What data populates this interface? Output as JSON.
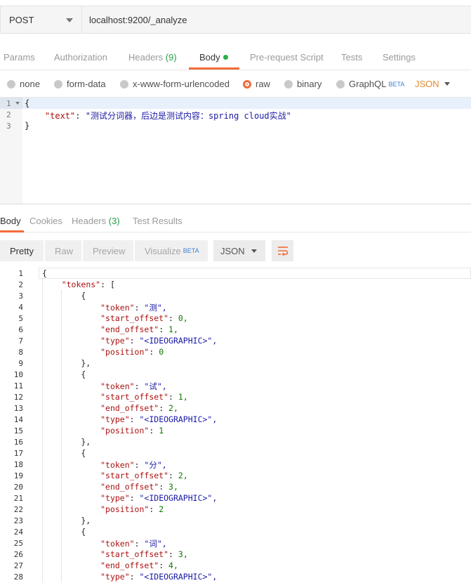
{
  "request": {
    "method": "POST",
    "url": "localhost:9200/_analyze"
  },
  "request_tabs": {
    "params": "Params",
    "authorization": "Authorization",
    "headers": "Headers",
    "headers_count": "(9)",
    "body": "Body",
    "pre_request": "Pre-request Script",
    "tests": "Tests",
    "settings": "Settings"
  },
  "body_types": {
    "none": "none",
    "form_data": "form-data",
    "urlencoded": "x-www-form-urlencoded",
    "raw": "raw",
    "binary": "binary",
    "graphql": "GraphQL",
    "graphql_badge": "BETA",
    "format": "JSON",
    "selected": "raw"
  },
  "request_body": {
    "line_numbers": [
      "1",
      "2",
      "3"
    ],
    "open_brace": "{",
    "key": "\"text\"",
    "colon": ": ",
    "value": "\"测试分词器，后边是测试内容：spring cloud实战\"",
    "close_brace": "}"
  },
  "response_tabs": {
    "body": "Body",
    "cookies": "Cookies",
    "headers": "Headers",
    "headers_count": "(3)",
    "test_results": "Test Results"
  },
  "response_toolbar": {
    "pretty": "Pretty",
    "raw": "Raw",
    "preview": "Preview",
    "visualize": "Visualize",
    "visualize_badge": "BETA",
    "format": "JSON"
  },
  "response_body": {
    "lines": [
      {
        "n": "1",
        "text": "{"
      },
      {
        "n": "2",
        "text": "    \"tokens\": ["
      },
      {
        "n": "3",
        "text": "        {"
      },
      {
        "n": "4",
        "text": "            \"token\": \"测\","
      },
      {
        "n": "5",
        "text": "            \"start_offset\": 0,"
      },
      {
        "n": "6",
        "text": "            \"end_offset\": 1,"
      },
      {
        "n": "7",
        "text": "            \"type\": \"<IDEOGRAPHIC>\","
      },
      {
        "n": "8",
        "text": "            \"position\": 0"
      },
      {
        "n": "9",
        "text": "        },"
      },
      {
        "n": "10",
        "text": "        {"
      },
      {
        "n": "11",
        "text": "            \"token\": \"试\","
      },
      {
        "n": "12",
        "text": "            \"start_offset\": 1,"
      },
      {
        "n": "13",
        "text": "            \"end_offset\": 2,"
      },
      {
        "n": "14",
        "text": "            \"type\": \"<IDEOGRAPHIC>\","
      },
      {
        "n": "15",
        "text": "            \"position\": 1"
      },
      {
        "n": "16",
        "text": "        },"
      },
      {
        "n": "17",
        "text": "        {"
      },
      {
        "n": "18",
        "text": "            \"token\": \"分\","
      },
      {
        "n": "19",
        "text": "            \"start_offset\": 2,"
      },
      {
        "n": "20",
        "text": "            \"end_offset\": 3,"
      },
      {
        "n": "21",
        "text": "            \"type\": \"<IDEOGRAPHIC>\","
      },
      {
        "n": "22",
        "text": "            \"position\": 2"
      },
      {
        "n": "23",
        "text": "        },"
      },
      {
        "n": "24",
        "text": "        {"
      },
      {
        "n": "25",
        "text": "            \"token\": \"词\","
      },
      {
        "n": "26",
        "text": "            \"start_offset\": 3,"
      },
      {
        "n": "27",
        "text": "            \"end_offset\": 4,"
      },
      {
        "n": "28",
        "text": "            \"type\": \"<IDEOGRAPHIC>\","
      }
    ]
  },
  "colors": {
    "accent": "#f26b3a",
    "count_green": "#26a04a",
    "json_key": "#a11",
    "json_string": "#1a1aa6",
    "json_number": "#117700"
  }
}
